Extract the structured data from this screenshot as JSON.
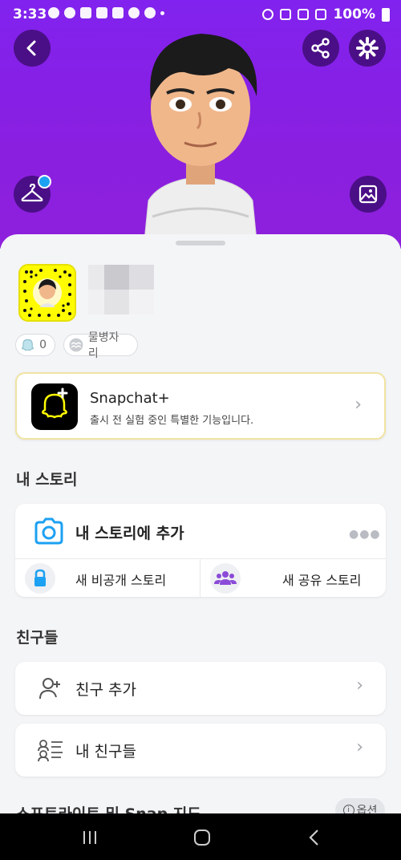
{
  "status_bar": {
    "time": "3:33",
    "battery": "100%"
  },
  "profile": {
    "score": "0",
    "zodiac": "물병자리"
  },
  "snapchat_plus": {
    "title": "Snapchat+",
    "subtitle": "출시 전 실험 중인 특별한 기능입니다."
  },
  "stories": {
    "section_title": "내 스토리",
    "add_story": "내 스토리에 추가",
    "private_story": "새 비공개 스토리",
    "shared_story": "새 공유 스토리"
  },
  "friends": {
    "section_title": "친구들",
    "add_friends": "친구 추가",
    "my_friends": "내 친구들"
  },
  "spotlight": {
    "section_title": "스포트라이트 및 Snap 지도",
    "options": "옵션"
  },
  "icons": {
    "back": "back-icon",
    "share": "share-icon",
    "settings": "gear-icon",
    "outfit": "hanger-icon",
    "background": "image-icon"
  },
  "colors": {
    "hero": "#8122ee",
    "accent_blue": "#1da1f2",
    "snap_yellow": "#fffc00"
  }
}
